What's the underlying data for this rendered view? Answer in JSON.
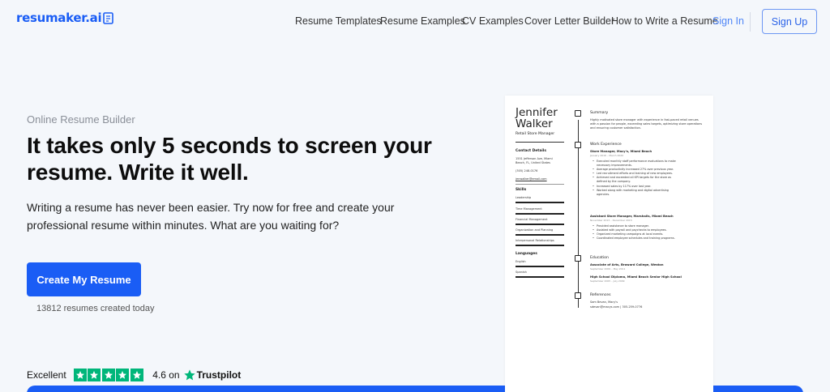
{
  "header": {
    "logo_text": "resumaker.ai",
    "nav": [
      "Resume Templates",
      "Resume Examples",
      "CV Examples",
      "Cover Letter Builder",
      "How to Write a Resume"
    ],
    "sign_in": "Sign In",
    "sign_up": "Sign Up"
  },
  "hero": {
    "eyebrow": "Online Resume Builder",
    "headline": "It takes only 5 seconds to screen your resume. Write it well.",
    "lead": "Writing a resume has never been easier. Try now for free and create your professional resume within minutes. What are you waiting for?",
    "cta": "Create My Resume",
    "count": "13812 resumes created today"
  },
  "trust": {
    "label": "Excellent",
    "rating": "4.6 on",
    "brand": "Trustpilot",
    "stars": 5,
    "color": "#00b67a"
  },
  "resume": {
    "first_name": "Jennifer",
    "last_name": "Walker",
    "title": "Retail Store Manager",
    "contact_heading": "Contact Details",
    "contact": [
      "1551 Jefferson Ave, Miami",
      "Beach, FL, United States",
      "(305) 248-0176",
      "jenwalker@email.com"
    ],
    "skills_heading": "Skills",
    "skills": [
      "Leadership",
      "Time Management",
      "Financial Management",
      "Organization and Planning",
      "Interpersonal Relationships"
    ],
    "languages_heading": "Languages",
    "languages": [
      "English",
      "Spanish"
    ],
    "summary_heading": "Summary",
    "summary": "Highly motivated store manager with experience in fast-paced retail venues with a passion for people, exceeding sales targets, optimizing store operations and ensuring customer satisfaction.",
    "work_heading": "Work Experience",
    "job1_title": "Store Manager, Macy's, Miami Beach",
    "job1_date": "January 2016 – March 2020",
    "job1_bullets": [
      "Executed monthly staff performance evaluations to make",
      "necessary improvements.",
      "Average productivity increased 27% over previous year.",
      "Led recruitment efforts and training of new employees.",
      "Achieved and exceeded all KPI targets for the store as",
      "defined by the company.",
      "Increased sales by 117% over last year.",
      "Worked along with marketing and digital advertising",
      "agencies."
    ],
    "job2_title": "Assistant Store Manager, Marshalls, Miami Beach",
    "job2_date": "November 2013 – December 2015",
    "job2_bullets": [
      "Provided assistance to store manager.",
      "Assisted with payroll and paychecks to employees.",
      "Organized marketing campaigns at local events.",
      "Coordinated employee schedules and training programs."
    ],
    "education_heading": "Education",
    "edu1_title": "Associate of Arts, Broward College, Weston",
    "edu1_date": "September 2009 – May 2011",
    "edu2_title": "High School Diploma, Miami Beach Senior High School",
    "edu2_date": "September 2005 – July 2009",
    "references_heading": "References",
    "ref1": "Sam Bevan, Macy's",
    "ref2": "sdevan@macys.com | 305-259-0776"
  }
}
